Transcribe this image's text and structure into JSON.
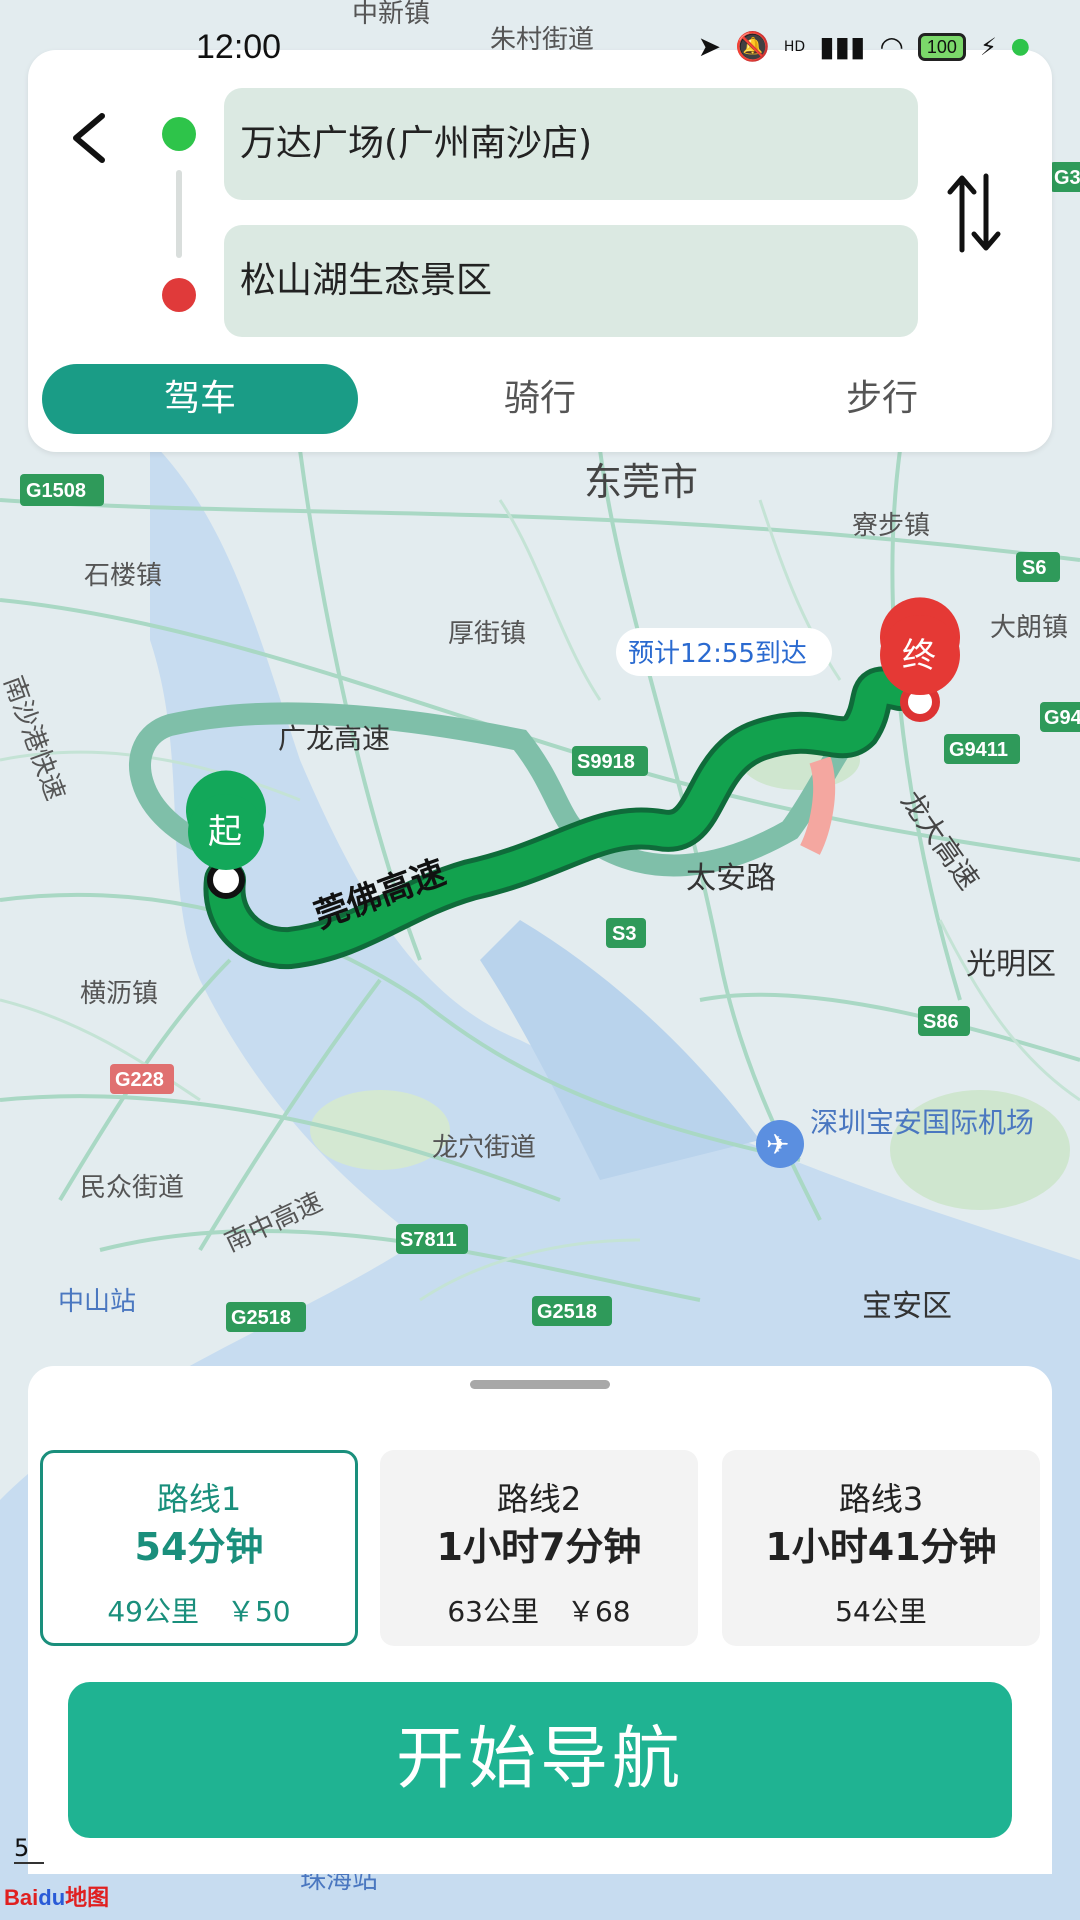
{
  "status_bar": {
    "time": "12:00",
    "battery": "100",
    "hd_label": "HD"
  },
  "search": {
    "start": "万达广场(广州南沙店)",
    "end": "松山湖生态景区"
  },
  "modes": [
    {
      "label": "驾车",
      "active": true
    },
    {
      "label": "骑行",
      "active": false
    },
    {
      "label": "步行",
      "active": false
    }
  ],
  "map": {
    "eta": "预计12:55到达",
    "start_marker": "起",
    "end_marker": "终",
    "place_labels": [
      "中新镇",
      "朱村街道",
      "东莞市",
      "寮步镇",
      "石楼镇",
      "厚街镇",
      "大朗镇",
      "广龙高速",
      "莞佛高速",
      "太安路",
      "龙大高速",
      "光明区",
      "横沥镇",
      "龙穴街道",
      "深圳宝安国际机场",
      "民众街道",
      "南中高速",
      "中山站",
      "宝安区",
      "南沙港快速",
      "珠海站"
    ],
    "road_shields": [
      "G1508",
      "S6",
      "S9918",
      "G9411",
      "S3",
      "S86",
      "G228",
      "S7811",
      "G2518",
      "G2518",
      "G3",
      "G94"
    ]
  },
  "routes": [
    {
      "name": "路线1",
      "time": "54分钟",
      "meta": "49公里　￥50",
      "active": true
    },
    {
      "name": "路线2",
      "time": "1小时7分钟",
      "meta": "63公里　￥68",
      "active": false
    },
    {
      "name": "路线3",
      "time": "1小时41分钟",
      "meta": "54公里",
      "active": false
    }
  ],
  "navigate_button": "开始导航",
  "page_number": "5",
  "watermark": "Baidu地图",
  "colors": {
    "accent": "#1a9c86",
    "button": "#1fb392",
    "route": "#12a24e",
    "start_dot": "#2ec44a",
    "end_dot": "#e03a3a"
  }
}
